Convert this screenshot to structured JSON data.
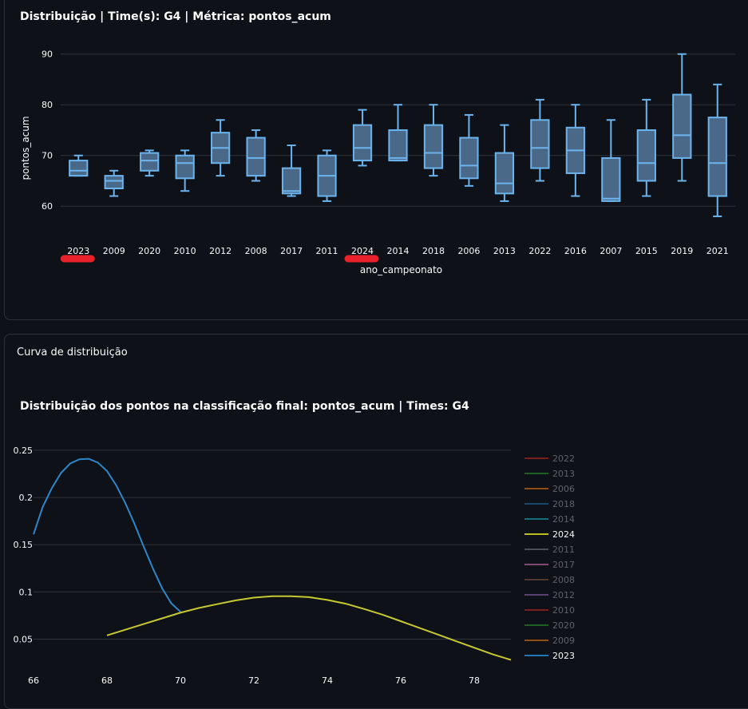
{
  "chart_data": [
    {
      "type": "box",
      "title": "Distribuição | Time(s): G4 | Métrica: pontos_acum",
      "xlabel": "ano_campeonato",
      "ylabel": "pontos_acum",
      "ylim": [
        55,
        92
      ],
      "yticks": [
        60,
        70,
        80,
        90
      ],
      "grid": true,
      "color": "#6cb4ee",
      "highlighted_categories": [
        "2023",
        "2024"
      ],
      "categories": [
        "2023",
        "2009",
        "2020",
        "2010",
        "2012",
        "2008",
        "2017",
        "2011",
        "2024",
        "2014",
        "2018",
        "2006",
        "2013",
        "2022",
        "2016",
        "2007",
        "2015",
        "2019",
        "2021"
      ],
      "boxes": [
        {
          "min": 66,
          "q1": 66,
          "median": 67,
          "q3": 69,
          "max": 70
        },
        {
          "min": 62,
          "q1": 63.5,
          "median": 65,
          "q3": 66,
          "max": 67
        },
        {
          "min": 66,
          "q1": 67,
          "median": 69,
          "q3": 70.5,
          "max": 71
        },
        {
          "min": 63,
          "q1": 65.5,
          "median": 68.5,
          "q3": 70,
          "max": 71
        },
        {
          "min": 66,
          "q1": 68.5,
          "median": 71.5,
          "q3": 74.5,
          "max": 77
        },
        {
          "min": 65,
          "q1": 66,
          "median": 69.5,
          "q3": 73.5,
          "max": 75
        },
        {
          "min": 62,
          "q1": 62.5,
          "median": 63,
          "q3": 67.5,
          "max": 72
        },
        {
          "min": 61,
          "q1": 62,
          "median": 66,
          "q3": 70,
          "max": 71
        },
        {
          "min": 68,
          "q1": 69,
          "median": 71.5,
          "q3": 76,
          "max": 79
        },
        {
          "min": 69,
          "q1": 69,
          "median": 69.5,
          "q3": 75,
          "max": 80
        },
        {
          "min": 66,
          "q1": 67.5,
          "median": 70.5,
          "q3": 76,
          "max": 80
        },
        {
          "min": 64,
          "q1": 65.5,
          "median": 68,
          "q3": 73.5,
          "max": 78
        },
        {
          "min": 61,
          "q1": 62.5,
          "median": 64.5,
          "q3": 70.5,
          "max": 76
        },
        {
          "min": 65,
          "q1": 67.5,
          "median": 71.5,
          "q3": 77,
          "max": 81
        },
        {
          "min": 62,
          "q1": 66.5,
          "median": 71,
          "q3": 75.5,
          "max": 80
        },
        {
          "min": 61,
          "q1": 61,
          "median": 61.5,
          "q3": 69.5,
          "max": 77
        },
        {
          "min": 62,
          "q1": 65,
          "median": 68.5,
          "q3": 75,
          "max": 81
        },
        {
          "min": 65,
          "q1": 69.5,
          "median": 74,
          "q3": 82,
          "max": 90
        },
        {
          "min": 58,
          "q1": 62,
          "median": 68.5,
          "q3": 77.5,
          "max": 84
        }
      ]
    },
    {
      "type": "line",
      "title": "Distribuição dos pontos na classificação final: pontos_acum | Times: G4",
      "xlim": [
        66,
        79
      ],
      "xticks": [
        66,
        68,
        70,
        72,
        74,
        76,
        78
      ],
      "ylim": [
        0.02,
        0.255
      ],
      "yticks": [
        0.05,
        0.1,
        0.15,
        0.2,
        0.25
      ],
      "yticklabels": [
        "0.05",
        "0.1",
        "0.15",
        "0.2",
        "0.25"
      ],
      "grid": true,
      "legend_position": "right",
      "legend": [
        {
          "name": "2022",
          "color": "#d62728",
          "active": false
        },
        {
          "name": "2013",
          "color": "#2ca02c",
          "active": false
        },
        {
          "name": "2006",
          "color": "#ff7f0e",
          "active": false
        },
        {
          "name": "2018",
          "color": "#1f77b4",
          "active": false
        },
        {
          "name": "2014",
          "color": "#17becf",
          "active": false
        },
        {
          "name": "2024",
          "color": "#bcbd22",
          "active": true
        },
        {
          "name": "2011",
          "color": "#7f7f7f",
          "active": false
        },
        {
          "name": "2017",
          "color": "#e377c2",
          "active": false
        },
        {
          "name": "2008",
          "color": "#8c564b",
          "active": false
        },
        {
          "name": "2012",
          "color": "#9467bd",
          "active": false
        },
        {
          "name": "2010",
          "color": "#d62728",
          "active": false
        },
        {
          "name": "2020",
          "color": "#2ca02c",
          "active": false
        },
        {
          "name": "2009",
          "color": "#ff7f0e",
          "active": false
        },
        {
          "name": "2023",
          "color": "#1f77b4",
          "active": true
        }
      ],
      "series": [
        {
          "name": "2023",
          "color": "#2e86c8",
          "x": [
            66,
            66.25,
            66.5,
            66.75,
            67,
            67.25,
            67.5,
            67.75,
            68,
            68.25,
            68.5,
            68.75,
            69,
            69.25,
            69.5,
            69.75,
            70
          ],
          "y": [
            0.161,
            0.19,
            0.21,
            0.226,
            0.236,
            0.2405,
            0.241,
            0.237,
            0.228,
            0.213,
            0.194,
            0.172,
            0.148,
            0.125,
            0.104,
            0.088,
            0.079
          ]
        },
        {
          "name": "2024",
          "color": "#c8c832",
          "x": [
            68,
            68.5,
            69,
            69.5,
            70,
            70.5,
            71,
            71.5,
            72,
            72.5,
            73,
            73.5,
            74,
            74.5,
            75,
            75.5,
            76,
            76.5,
            77,
            77.5,
            78,
            78.5,
            79
          ],
          "y": [
            0.054,
            0.06,
            0.066,
            0.072,
            0.078,
            0.083,
            0.087,
            0.091,
            0.094,
            0.0955,
            0.0955,
            0.0945,
            0.0915,
            0.0875,
            0.082,
            0.076,
            0.069,
            0.062,
            0.055,
            0.048,
            0.041,
            0.034,
            0.028
          ]
        }
      ]
    }
  ],
  "section2": {
    "header": "Curva de distribuição"
  },
  "highlight_color": "#e8212b"
}
